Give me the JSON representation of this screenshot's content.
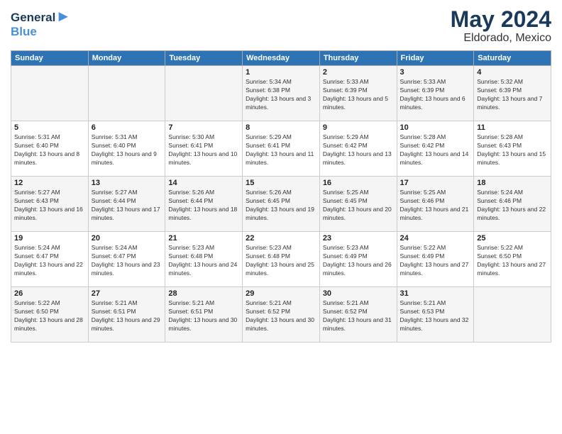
{
  "logo": {
    "line1": "General",
    "line2": "Blue"
  },
  "title": "May 2024",
  "subtitle": "Eldorado, Mexico",
  "days_of_week": [
    "Sunday",
    "Monday",
    "Tuesday",
    "Wednesday",
    "Thursday",
    "Friday",
    "Saturday"
  ],
  "weeks": [
    [
      {
        "day": "",
        "info": ""
      },
      {
        "day": "",
        "info": ""
      },
      {
        "day": "",
        "info": ""
      },
      {
        "day": "1",
        "info": "Sunrise: 5:34 AM\nSunset: 6:38 PM\nDaylight: 13 hours and 3 minutes."
      },
      {
        "day": "2",
        "info": "Sunrise: 5:33 AM\nSunset: 6:39 PM\nDaylight: 13 hours and 5 minutes."
      },
      {
        "day": "3",
        "info": "Sunrise: 5:33 AM\nSunset: 6:39 PM\nDaylight: 13 hours and 6 minutes."
      },
      {
        "day": "4",
        "info": "Sunrise: 5:32 AM\nSunset: 6:39 PM\nDaylight: 13 hours and 7 minutes."
      }
    ],
    [
      {
        "day": "5",
        "info": "Sunrise: 5:31 AM\nSunset: 6:40 PM\nDaylight: 13 hours and 8 minutes."
      },
      {
        "day": "6",
        "info": "Sunrise: 5:31 AM\nSunset: 6:40 PM\nDaylight: 13 hours and 9 minutes."
      },
      {
        "day": "7",
        "info": "Sunrise: 5:30 AM\nSunset: 6:41 PM\nDaylight: 13 hours and 10 minutes."
      },
      {
        "day": "8",
        "info": "Sunrise: 5:29 AM\nSunset: 6:41 PM\nDaylight: 13 hours and 11 minutes."
      },
      {
        "day": "9",
        "info": "Sunrise: 5:29 AM\nSunset: 6:42 PM\nDaylight: 13 hours and 13 minutes."
      },
      {
        "day": "10",
        "info": "Sunrise: 5:28 AM\nSunset: 6:42 PM\nDaylight: 13 hours and 14 minutes."
      },
      {
        "day": "11",
        "info": "Sunrise: 5:28 AM\nSunset: 6:43 PM\nDaylight: 13 hours and 15 minutes."
      }
    ],
    [
      {
        "day": "12",
        "info": "Sunrise: 5:27 AM\nSunset: 6:43 PM\nDaylight: 13 hours and 16 minutes."
      },
      {
        "day": "13",
        "info": "Sunrise: 5:27 AM\nSunset: 6:44 PM\nDaylight: 13 hours and 17 minutes."
      },
      {
        "day": "14",
        "info": "Sunrise: 5:26 AM\nSunset: 6:44 PM\nDaylight: 13 hours and 18 minutes."
      },
      {
        "day": "15",
        "info": "Sunrise: 5:26 AM\nSunset: 6:45 PM\nDaylight: 13 hours and 19 minutes."
      },
      {
        "day": "16",
        "info": "Sunrise: 5:25 AM\nSunset: 6:45 PM\nDaylight: 13 hours and 20 minutes."
      },
      {
        "day": "17",
        "info": "Sunrise: 5:25 AM\nSunset: 6:46 PM\nDaylight: 13 hours and 21 minutes."
      },
      {
        "day": "18",
        "info": "Sunrise: 5:24 AM\nSunset: 6:46 PM\nDaylight: 13 hours and 22 minutes."
      }
    ],
    [
      {
        "day": "19",
        "info": "Sunrise: 5:24 AM\nSunset: 6:47 PM\nDaylight: 13 hours and 22 minutes."
      },
      {
        "day": "20",
        "info": "Sunrise: 5:24 AM\nSunset: 6:47 PM\nDaylight: 13 hours and 23 minutes."
      },
      {
        "day": "21",
        "info": "Sunrise: 5:23 AM\nSunset: 6:48 PM\nDaylight: 13 hours and 24 minutes."
      },
      {
        "day": "22",
        "info": "Sunrise: 5:23 AM\nSunset: 6:48 PM\nDaylight: 13 hours and 25 minutes."
      },
      {
        "day": "23",
        "info": "Sunrise: 5:23 AM\nSunset: 6:49 PM\nDaylight: 13 hours and 26 minutes."
      },
      {
        "day": "24",
        "info": "Sunrise: 5:22 AM\nSunset: 6:49 PM\nDaylight: 13 hours and 27 minutes."
      },
      {
        "day": "25",
        "info": "Sunrise: 5:22 AM\nSunset: 6:50 PM\nDaylight: 13 hours and 27 minutes."
      }
    ],
    [
      {
        "day": "26",
        "info": "Sunrise: 5:22 AM\nSunset: 6:50 PM\nDaylight: 13 hours and 28 minutes."
      },
      {
        "day": "27",
        "info": "Sunrise: 5:21 AM\nSunset: 6:51 PM\nDaylight: 13 hours and 29 minutes."
      },
      {
        "day": "28",
        "info": "Sunrise: 5:21 AM\nSunset: 6:51 PM\nDaylight: 13 hours and 30 minutes."
      },
      {
        "day": "29",
        "info": "Sunrise: 5:21 AM\nSunset: 6:52 PM\nDaylight: 13 hours and 30 minutes."
      },
      {
        "day": "30",
        "info": "Sunrise: 5:21 AM\nSunset: 6:52 PM\nDaylight: 13 hours and 31 minutes."
      },
      {
        "day": "31",
        "info": "Sunrise: 5:21 AM\nSunset: 6:53 PM\nDaylight: 13 hours and 32 minutes."
      },
      {
        "day": "",
        "info": ""
      }
    ]
  ]
}
